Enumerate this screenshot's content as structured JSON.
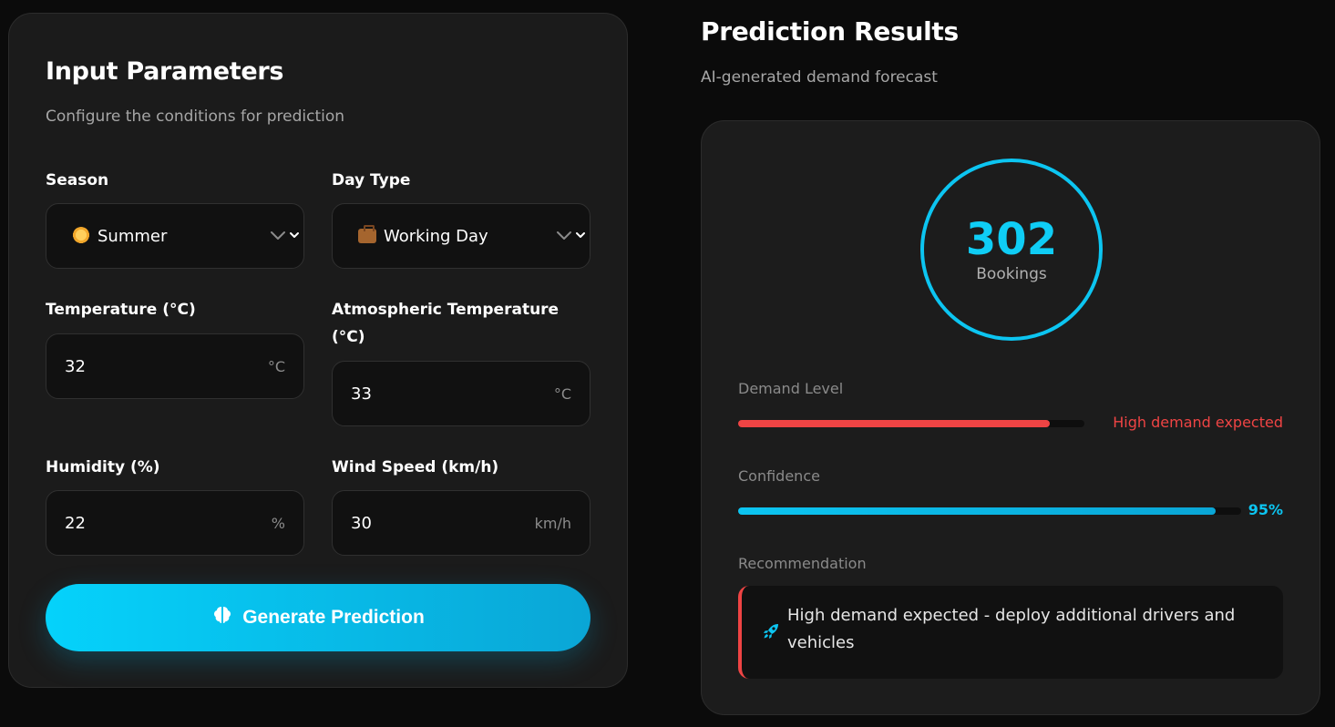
{
  "input": {
    "title": "Input Parameters",
    "subtitle": "Configure the conditions for prediction",
    "season": {
      "label": "Season",
      "value": "Summer",
      "icon": "sun-emoji"
    },
    "day_type": {
      "label": "Day Type",
      "value": "Working Day",
      "icon": "briefcase-emoji"
    },
    "temperature": {
      "label": "Temperature (°C)",
      "value": "32",
      "unit": "°C"
    },
    "atm_temperature": {
      "label": "Atmospheric Temperature (°C)",
      "value": "33",
      "unit": "°C"
    },
    "humidity": {
      "label": "Humidity (%)",
      "value": "22",
      "unit": "%"
    },
    "wind_speed": {
      "label": "Wind Speed (km/h)",
      "value": "30",
      "unit": "km/h"
    },
    "generate_label": "Generate Prediction",
    "generate_icon": "brain-icon"
  },
  "results": {
    "title": "Prediction Results",
    "subtitle": "AI-generated demand forecast",
    "bookings_value": "302",
    "bookings_label": "Bookings",
    "demand": {
      "label": "Demand Level",
      "text": "High demand expected",
      "level": 0.9,
      "color": "#ef4444"
    },
    "confidence": {
      "label": "Confidence",
      "text": "95%",
      "level": 0.95,
      "color": "#0cc5f1"
    },
    "recommendation": {
      "label": "Recommendation",
      "text": "High demand expected - deploy additional drivers and vehicles",
      "icon": "rocket-icon"
    }
  },
  "colors": {
    "accent": "#0cc5f1",
    "danger": "#ef4444",
    "panel": "#1b1b1b",
    "background": "#0b0b0b"
  }
}
